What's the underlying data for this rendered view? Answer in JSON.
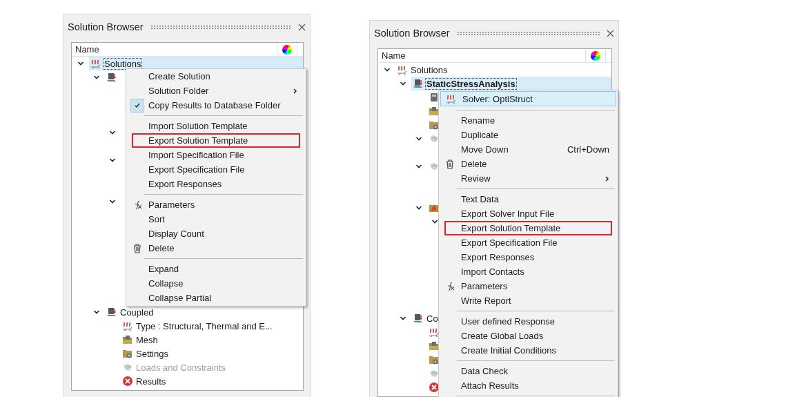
{
  "panels": [
    {
      "title": "Solution Browser",
      "column": "Name",
      "tree": [
        {
          "label": "Solutions",
          "kind": "heat",
          "expanded": true,
          "selected": true,
          "children": [
            {
              "kind": "solution",
              "expanded": true,
              "children": [
                {
                  "expanded": true
                },
                {
                  "expanded": true
                },
                {
                  "expanded": true
                }
              ]
            },
            {
              "label": "Coupled",
              "kind": "solution",
              "expanded": true,
              "selected": false,
              "children": [
                {
                  "label": "Type : Structural, Thermal and E...",
                  "kind": "heat",
                  "selected": false
                },
                {
                  "label": "Mesh",
                  "kind": "mesh",
                  "selected": false
                },
                {
                  "label": "Settings",
                  "kind": "settings",
                  "selected": false
                },
                {
                  "label": "Loads and Constraints",
                  "kind": "loads",
                  "disabled": true,
                  "selected": false
                },
                {
                  "label": "Results",
                  "kind": "results",
                  "selected": false
                }
              ]
            }
          ]
        }
      ],
      "menu": [
        {
          "kind": "plain",
          "label": "Create Solution",
          "checked": false,
          "annotated": false
        },
        {
          "kind": "plain",
          "label": "Solution Folder",
          "submenu": true,
          "checked": false,
          "annotated": false
        },
        {
          "kind": "plain",
          "label": "Copy Results to Database Folder",
          "checked": true,
          "annotated": false
        },
        {
          "kind": "separator"
        },
        {
          "kind": "plain",
          "label": "Import Solution Template",
          "checked": false,
          "annotated": false
        },
        {
          "kind": "plain",
          "label": "Export Solution Template",
          "checked": false,
          "annotated": true
        },
        {
          "kind": "plain",
          "label": "Import Specification File",
          "checked": false,
          "annotated": false
        },
        {
          "kind": "plain",
          "label": "Export Specification File",
          "checked": false,
          "annotated": false
        },
        {
          "kind": "plain",
          "label": "Export Responses",
          "checked": false,
          "annotated": false
        },
        {
          "kind": "separator"
        },
        {
          "kind": "function",
          "label": "Parameters",
          "checked": false,
          "annotated": false
        },
        {
          "kind": "plain",
          "label": "Sort",
          "checked": false,
          "annotated": false
        },
        {
          "kind": "plain",
          "label": "Display Count",
          "checked": false,
          "annotated": false
        },
        {
          "kind": "delete",
          "label": "Delete",
          "checked": false,
          "annotated": false
        },
        {
          "kind": "separator"
        },
        {
          "kind": "plain",
          "label": "Expand",
          "checked": false,
          "annotated": false
        },
        {
          "kind": "plain",
          "label": "Collapse",
          "checked": false,
          "annotated": false
        },
        {
          "kind": "plain",
          "label": "Collapse Partial",
          "checked": false,
          "annotated": false
        }
      ]
    },
    {
      "title": "Solution Browser",
      "column": "Name",
      "tree": [
        {
          "label": "Solutions",
          "kind": "heat",
          "expanded": true,
          "selected": false,
          "children": [
            {
              "label": "StaticStressAnalysis",
              "kind": "solution",
              "expanded": true,
              "selected": true,
              "active": true,
              "children": [
                {
                  "kind": "device"
                },
                {
                  "kind": "mesh"
                },
                {
                  "kind": "settings"
                },
                {
                  "kind": "loads",
                  "expanded": true
                },
                {
                  "kind": "loads",
                  "expanded": true
                },
                {
                  "kind": "outputs",
                  "expanded": true,
                  "children": [
                    {
                      "expanded": true
                    }
                  ]
                }
              ]
            },
            {
              "label": "Co",
              "kind": "solution",
              "expanded": true,
              "selected": false,
              "children": [
                {
                  "kind": "heat"
                },
                {
                  "kind": "mesh"
                },
                {
                  "kind": "settings"
                },
                {
                  "kind": "loads"
                },
                {
                  "kind": "results"
                }
              ]
            }
          ]
        }
      ],
      "menu": [
        {
          "kind": "solver",
          "label": "Solver: OptiStruct",
          "highlighted": true,
          "annotated": false
        },
        {
          "kind": "separator"
        },
        {
          "kind": "plain",
          "label": "Rename",
          "highlighted": false,
          "annotated": false
        },
        {
          "kind": "plain",
          "label": "Duplicate",
          "highlighted": false,
          "annotated": false
        },
        {
          "kind": "plain",
          "label": "Move Down",
          "shortcut": "Ctrl+Down",
          "highlighted": false,
          "annotated": false
        },
        {
          "kind": "delete",
          "label": "Delete",
          "highlighted": false,
          "annotated": false
        },
        {
          "kind": "plain",
          "label": "Review",
          "submenu": true,
          "highlighted": false,
          "annotated": false
        },
        {
          "kind": "separator"
        },
        {
          "kind": "plain",
          "label": "Text Data",
          "highlighted": false,
          "annotated": false
        },
        {
          "kind": "plain",
          "label": "Export Solver Input File",
          "highlighted": false,
          "annotated": false
        },
        {
          "kind": "plain",
          "label": "Export Solution Template",
          "highlighted": false,
          "annotated": true
        },
        {
          "kind": "plain",
          "label": "Export Specification File",
          "highlighted": false,
          "annotated": false
        },
        {
          "kind": "plain",
          "label": "Export Responses",
          "highlighted": false,
          "annotated": false
        },
        {
          "kind": "plain",
          "label": "Import Contacts",
          "highlighted": false,
          "annotated": false
        },
        {
          "kind": "function",
          "label": "Parameters",
          "highlighted": false,
          "annotated": false
        },
        {
          "kind": "plain",
          "label": "Write Report",
          "highlighted": false,
          "annotated": false
        },
        {
          "kind": "separator"
        },
        {
          "kind": "plain",
          "label": "User defined Response",
          "highlighted": false,
          "annotated": false
        },
        {
          "kind": "plain",
          "label": "Create Global Loads",
          "highlighted": false,
          "annotated": false
        },
        {
          "kind": "plain",
          "label": "Create Initial Conditions",
          "highlighted": false,
          "annotated": false
        },
        {
          "kind": "separator"
        },
        {
          "kind": "plain",
          "label": "Data Check",
          "highlighted": false,
          "annotated": false
        },
        {
          "kind": "plain",
          "label": "Attach Results",
          "highlighted": false,
          "annotated": false
        },
        {
          "kind": "separator"
        }
      ]
    }
  ]
}
